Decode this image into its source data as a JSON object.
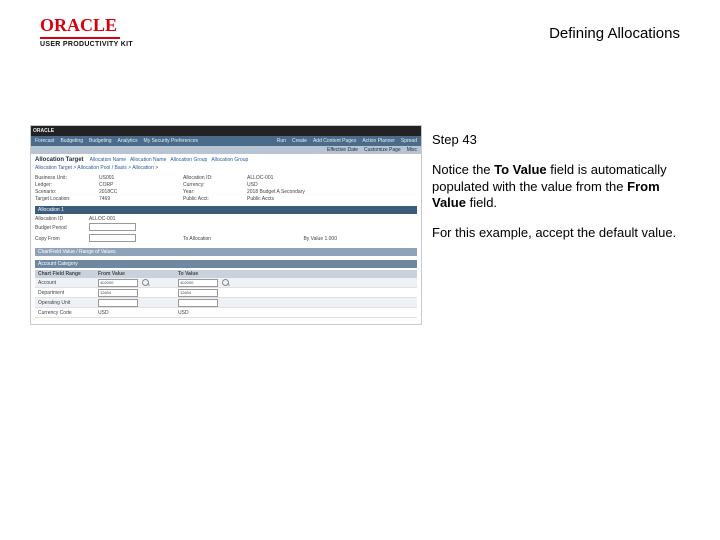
{
  "header": {
    "page_title": "Defining Allocations"
  },
  "logo": {
    "word": "ORACLE",
    "sub": "USER PRODUCTIVITY KIT"
  },
  "instructions": {
    "step_label": "Step 43",
    "p1_a": "Notice the ",
    "p1_b1": "To Value",
    "p1_c": " field is automatically populated with the value from the ",
    "p1_b2": "From Value",
    "p1_d": " field.",
    "p2": "For this example, accept the default value."
  },
  "shot": {
    "brand": "ORACLE",
    "nav": [
      "Forecast",
      "Budgeting",
      "Budgeting",
      "Analytics",
      "My Security Preferences",
      "Run",
      "Create",
      "Add Content Pages",
      "Action Planner",
      "Spread"
    ],
    "subnav": [
      "Effective Date",
      "Customize Page",
      "Misc"
    ],
    "title": "Allocation Target",
    "title_links": [
      "Allocation Name",
      "Allocation Name",
      "Allocation Group",
      "Allocation Group"
    ],
    "crumb": "Allocation Target  >  Allocation Pool / Basis  >  Allocation  >  ",
    "kv": {
      "l1": "Business Unit:",
      "v1": "US001",
      "l2": "Allocation ID:",
      "v2": "ALLOC-001",
      "l3": "Ledger:",
      "v3": "CORP",
      "l4": "Currency:",
      "v4": "USD",
      "l5": "Scenario:",
      "v5": "2018CC",
      "l6": "Year:",
      "v6": "2018 Budget A Secondary",
      "l7": "Target Location:",
      "v7": "7469",
      "l8": "Public Acct:",
      "v8": "Public Accts"
    },
    "sec_alloc": "Allocation 1",
    "pool": {
      "l1": "Allocation ID",
      "v1": "ALLOC-001",
      "l2": "",
      "v2": "",
      "l3": "Budget Period",
      "v3": "",
      "l4": "",
      "v4": "",
      "l5": "Copy From",
      "v5": "",
      "l6": "To Allocation",
      "v6": "By Value  1.000"
    },
    "sec_cf": "ChartField Value / Range of Values",
    "sec_acct": "Account Category",
    "table": {
      "h1": "Chart Field Range",
      "h2": "From Value",
      "h3": "To Value",
      "rows": [
        {
          "f": "Account",
          "from": "402000",
          "to": "402000",
          "alt": true
        },
        {
          "f": "Department",
          "from": "12604",
          "to": "12604",
          "alt": false
        },
        {
          "f": "Operating Unit",
          "from": "",
          "to": "",
          "alt": true
        },
        {
          "f": "Currency Code",
          "from": "USD",
          "to": "USD",
          "alt": false
        }
      ]
    }
  }
}
